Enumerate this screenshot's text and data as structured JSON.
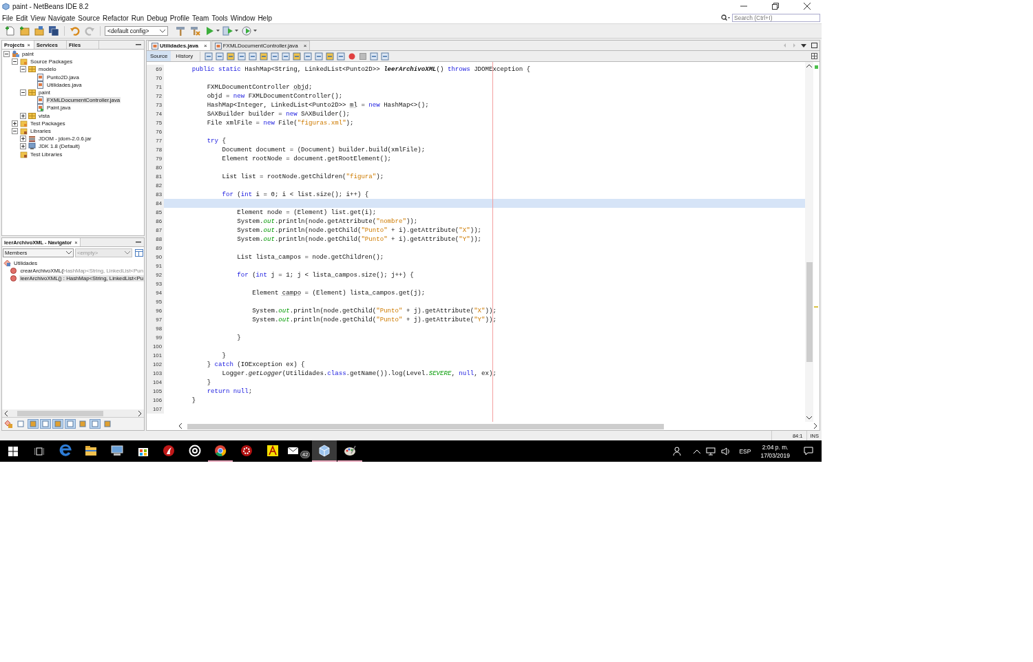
{
  "window": {
    "title": "paint - NetBeans IDE 8.2"
  },
  "menu": [
    "File",
    "Edit",
    "View",
    "Navigate",
    "Source",
    "Refactor",
    "Run",
    "Debug",
    "Profile",
    "Team",
    "Tools",
    "Window",
    "Help"
  ],
  "search": {
    "placeholder": "Search (Ctrl+I)"
  },
  "toolbar": {
    "config": "<default config>"
  },
  "projects": {
    "tabs": [
      {
        "label": "Projects",
        "close": "×",
        "selected": true
      },
      {
        "label": "Services",
        "selected": false
      },
      {
        "label": "Files",
        "selected": false
      }
    ],
    "tree": [
      {
        "label": "paint",
        "kind": "project",
        "expanded": true,
        "selected": false,
        "children": [
          {
            "label": "Source Packages",
            "kind": "source-root",
            "expanded": true,
            "selected": false,
            "children": [
              {
                "label": "modelo",
                "kind": "package",
                "expanded": true,
                "selected": false,
                "children": [
                  {
                    "label": "Punto2D.java",
                    "kind": "java-file",
                    "selected": false
                  },
                  {
                    "label": "Utilidades.java",
                    "kind": "java-file",
                    "selected": false
                  }
                ]
              },
              {
                "label": "paint",
                "kind": "package",
                "expanded": true,
                "selected": false,
                "children": [
                  {
                    "label": "FXMLDocumentController.java",
                    "kind": "java-file",
                    "selected": true
                  },
                  {
                    "label": "Paint.java",
                    "kind": "main-file",
                    "selected": false
                  }
                ]
              },
              {
                "label": "vista",
                "kind": "package",
                "expanded": false,
                "selected": false
              }
            ]
          },
          {
            "label": "Test Packages",
            "kind": "source-root",
            "expanded": false,
            "selected": false
          },
          {
            "label": "Libraries",
            "kind": "library-folder",
            "expanded": true,
            "selected": false,
            "children": [
              {
                "label": "JDOM - jdom-2.0.6.jar",
                "kind": "jar",
                "expanded": false,
                "selected": false
              },
              {
                "label": "JDK 1.8 (Default)",
                "kind": "jdk",
                "expanded": false,
                "selected": false
              }
            ]
          },
          {
            "label": "Test Libraries",
            "kind": "library-folder",
            "selected": false
          }
        ]
      }
    ]
  },
  "navigator": {
    "title": "leerArchivoXML - Navigator",
    "close": "×",
    "filter": {
      "value": "Members",
      "disabled": false
    },
    "scope": {
      "value": "<empty>",
      "disabled": true
    },
    "tree": [
      {
        "label": "Utilidades",
        "kind": "class",
        "selected": false,
        "children": [
          {
            "label": "crearArchivoXML(",
            "detail": "HashMap<String, LinkedList<Pun",
            "kind": "method",
            "selected": false
          },
          {
            "label": "leerArchivoXML() : ",
            "detail": "HashMap<String, LinkedList<Pu",
            "kind": "method",
            "selected": true
          }
        ]
      }
    ],
    "filters": [
      {
        "on": false
      },
      {
        "on": true
      },
      {
        "on": true
      },
      {
        "on": true
      },
      {
        "on": true
      },
      {
        "on": false
      },
      {
        "on": true
      },
      {
        "on": false
      }
    ]
  },
  "editor": {
    "tabs": [
      {
        "label": "Utilidades.java",
        "close": "×",
        "selected": true
      },
      {
        "label": "FXMLDocumentController.java",
        "close": "×",
        "selected": false
      }
    ],
    "views": [
      {
        "label": "Source",
        "selected": true
      },
      {
        "label": "History",
        "selected": false
      }
    ],
    "lines": [
      {
        "n": "69",
        "current": false,
        "tokens": [
          {
            "kind": "kw",
            "text": "    public static"
          },
          {
            "kind": "plain",
            "text": " HashMap<String, LinkedList<Punto2D>> "
          },
          {
            "kind": "decl",
            "text": "leerArchivoXML"
          },
          {
            "kind": "plain",
            "text": "() "
          },
          {
            "kind": "kw",
            "text": "throws"
          },
          {
            "kind": "plain",
            "text": " JDOMException {"
          }
        ]
      },
      {
        "n": "70",
        "current": false
      },
      {
        "n": "71",
        "current": false,
        "tokens": [
          {
            "kind": "plain",
            "text": "        FXMLDocumentController "
          },
          {
            "kind": "warn",
            "text": "objd"
          },
          {
            "kind": "plain",
            "text": ";"
          }
        ]
      },
      {
        "n": "72",
        "current": false,
        "tokens": [
          {
            "kind": "plain",
            "text": "        objd = "
          },
          {
            "kind": "kw",
            "text": "new"
          },
          {
            "kind": "plain",
            "text": " FXMLDocumentController();"
          }
        ]
      },
      {
        "n": "73",
        "current": false,
        "tokens": [
          {
            "kind": "plain",
            "text": "        HashMap<Integer, LinkedList<Punto2D>> "
          },
          {
            "kind": "warn",
            "text": "ml"
          },
          {
            "kind": "plain",
            "text": " = "
          },
          {
            "kind": "kw",
            "text": "new"
          },
          {
            "kind": "plain",
            "text": " HashMap<>();"
          }
        ]
      },
      {
        "n": "74",
        "current": false,
        "tokens": [
          {
            "kind": "plain",
            "text": "        SAXBuilder builder = "
          },
          {
            "kind": "kw",
            "text": "new"
          },
          {
            "kind": "plain",
            "text": " SAXBuilder();"
          }
        ]
      },
      {
        "n": "75",
        "current": false,
        "tokens": [
          {
            "kind": "plain",
            "text": "        File xmlFile = "
          },
          {
            "kind": "kw",
            "text": "new"
          },
          {
            "kind": "plain",
            "text": " File("
          },
          {
            "kind": "str",
            "text": "\"figuras.xml\""
          },
          {
            "kind": "plain",
            "text": ");"
          }
        ]
      },
      {
        "n": "76",
        "current": false
      },
      {
        "n": "77",
        "current": false,
        "tokens": [
          {
            "kind": "kw",
            "text": "        try"
          },
          {
            "kind": "plain",
            "text": " {"
          }
        ]
      },
      {
        "n": "78",
        "current": false,
        "tokens": [
          {
            "kind": "plain",
            "text": "            Document document = (Document) builder.build(xmlFile);"
          }
        ]
      },
      {
        "n": "79",
        "current": false,
        "tokens": [
          {
            "kind": "plain",
            "text": "            Element rootNode = document.getRootElement();"
          }
        ]
      },
      {
        "n": "80",
        "current": false
      },
      {
        "n": "81",
        "current": false,
        "tokens": [
          {
            "kind": "plain",
            "text": "            List list = rootNode.getChildren("
          },
          {
            "kind": "str",
            "text": "\"figura\""
          },
          {
            "kind": "plain",
            "text": ");"
          }
        ]
      },
      {
        "n": "82",
        "current": false
      },
      {
        "n": "83",
        "current": false,
        "tokens": [
          {
            "kind": "kw",
            "text": "            for"
          },
          {
            "kind": "plain",
            "text": " ("
          },
          {
            "kind": "kw",
            "text": "int"
          },
          {
            "kind": "plain",
            "text": " i = 0; i < list.size(); i++) {"
          }
        ]
      },
      {
        "n": "84",
        "current": true
      },
      {
        "n": "85",
        "current": false,
        "tokens": [
          {
            "kind": "plain",
            "text": "                Element node = (Element) list.get(i);"
          }
        ]
      },
      {
        "n": "86",
        "current": false,
        "tokens": [
          {
            "kind": "plain",
            "text": "                System."
          },
          {
            "kind": "field",
            "text": "out"
          },
          {
            "kind": "plain",
            "text": ".println(node.getAttribute("
          },
          {
            "kind": "str",
            "text": "\"nombre\""
          },
          {
            "kind": "plain",
            "text": "));"
          }
        ]
      },
      {
        "n": "87",
        "current": false,
        "tokens": [
          {
            "kind": "plain",
            "text": "                System."
          },
          {
            "kind": "field",
            "text": "out"
          },
          {
            "kind": "plain",
            "text": ".println(node.getChild("
          },
          {
            "kind": "str",
            "text": "\"Punto\""
          },
          {
            "kind": "plain",
            "text": " + i).getAttribute("
          },
          {
            "kind": "str",
            "text": "\"X\""
          },
          {
            "kind": "plain",
            "text": "));"
          }
        ]
      },
      {
        "n": "88",
        "current": false,
        "tokens": [
          {
            "kind": "plain",
            "text": "                System."
          },
          {
            "kind": "field",
            "text": "out"
          },
          {
            "kind": "plain",
            "text": ".println(node.getChild("
          },
          {
            "kind": "str",
            "text": "\"Punto\""
          },
          {
            "kind": "plain",
            "text": " + i).getAttribute("
          },
          {
            "kind": "str",
            "text": "\"Y\""
          },
          {
            "kind": "plain",
            "text": "));"
          }
        ]
      },
      {
        "n": "89",
        "current": false
      },
      {
        "n": "90",
        "current": false,
        "tokens": [
          {
            "kind": "plain",
            "text": "                List lista_campos = node.getChildren();"
          }
        ]
      },
      {
        "n": "91",
        "current": false
      },
      {
        "n": "92",
        "current": false,
        "tokens": [
          {
            "kind": "kw",
            "text": "                for"
          },
          {
            "kind": "plain",
            "text": " ("
          },
          {
            "kind": "kw",
            "text": "int"
          },
          {
            "kind": "plain",
            "text": " j = 1; j < lista_campos.size(); j++) {"
          }
        ]
      },
      {
        "n": "93",
        "current": false
      },
      {
        "n": "94",
        "current": false,
        "tokens": [
          {
            "kind": "plain",
            "text": "                    Element "
          },
          {
            "kind": "warn",
            "text": "campo"
          },
          {
            "kind": "plain",
            "text": " = (Element) lista_campos.get(j);"
          }
        ]
      },
      {
        "n": "95",
        "current": false
      },
      {
        "n": "96",
        "current": false,
        "tokens": [
          {
            "kind": "plain",
            "text": "                    System."
          },
          {
            "kind": "field",
            "text": "out"
          },
          {
            "kind": "plain",
            "text": ".println(node.getChild("
          },
          {
            "kind": "str",
            "text": "\"Punto\""
          },
          {
            "kind": "plain",
            "text": " + j).getAttribute("
          },
          {
            "kind": "str",
            "text": "\"X\""
          },
          {
            "kind": "plain",
            "text": "));"
          }
        ]
      },
      {
        "n": "97",
        "current": false,
        "tokens": [
          {
            "kind": "plain",
            "text": "                    System."
          },
          {
            "kind": "field",
            "text": "out"
          },
          {
            "kind": "plain",
            "text": ".println(node.getChild("
          },
          {
            "kind": "str",
            "text": "\"Punto\""
          },
          {
            "kind": "plain",
            "text": " + j).getAttribute("
          },
          {
            "kind": "str",
            "text": "\"Y\""
          },
          {
            "kind": "plain",
            "text": "));"
          }
        ]
      },
      {
        "n": "98",
        "current": false
      },
      {
        "n": "99",
        "current": false,
        "tokens": [
          {
            "kind": "plain",
            "text": "                }"
          }
        ]
      },
      {
        "n": "100",
        "current": false
      },
      {
        "n": "101",
        "current": false,
        "tokens": [
          {
            "kind": "plain",
            "text": "            }"
          }
        ]
      },
      {
        "n": "102",
        "current": false,
        "tokens": [
          {
            "kind": "plain",
            "text": "        } "
          },
          {
            "kind": "kw",
            "text": "catch"
          },
          {
            "kind": "plain",
            "text": " (IOException ex) {"
          }
        ]
      },
      {
        "n": "103",
        "current": false,
        "tokens": [
          {
            "kind": "plain",
            "text": "            Logger."
          },
          {
            "kind": "static",
            "text": "getLogger"
          },
          {
            "kind": "plain",
            "text": "(Utilidades."
          },
          {
            "kind": "kw",
            "text": "class"
          },
          {
            "kind": "plain",
            "text": ".getName()).log(Level."
          },
          {
            "kind": "field",
            "text": "SEVERE"
          },
          {
            "kind": "plain",
            "text": ", "
          },
          {
            "kind": "kw",
            "text": "null"
          },
          {
            "kind": "plain",
            "text": ", ex);"
          }
        ]
      },
      {
        "n": "104",
        "current": false,
        "tokens": [
          {
            "kind": "plain",
            "text": "        }"
          }
        ]
      },
      {
        "n": "105",
        "current": false,
        "tokens": [
          {
            "kind": "kw",
            "text": "        return null"
          },
          {
            "kind": "plain",
            "text": ";"
          }
        ]
      },
      {
        "n": "106",
        "current": false,
        "tokens": [
          {
            "kind": "plain",
            "text": "    }"
          }
        ]
      },
      {
        "n": "107",
        "current": false
      }
    ]
  },
  "status_bar": {
    "position": "84:1",
    "mode": "INS"
  },
  "taskbar": {
    "apps": [
      {
        "kind": "edge",
        "running": false,
        "selected": false
      },
      {
        "kind": "folder",
        "running": false,
        "selected": false
      },
      {
        "kind": "computer",
        "running": false,
        "selected": false
      },
      {
        "kind": "store",
        "running": false,
        "selected": false
      },
      {
        "kind": "flame",
        "running": false,
        "selected": false
      },
      {
        "kind": "ring",
        "running": false,
        "selected": false
      },
      {
        "kind": "chrome",
        "running": true,
        "selected": false
      },
      {
        "kind": "gear",
        "running": false,
        "selected": false
      },
      {
        "kind": "yellow",
        "running": false,
        "selected": false
      },
      {
        "kind": "mail",
        "running": false,
        "selected": false,
        "badge": "42"
      },
      {
        "kind": "cube",
        "running": true,
        "selected": true
      },
      {
        "kind": "palette",
        "running": true,
        "selected": false
      }
    ],
    "language": "ESP",
    "time": "2:04 p. m.",
    "date": "17/03/2019"
  }
}
